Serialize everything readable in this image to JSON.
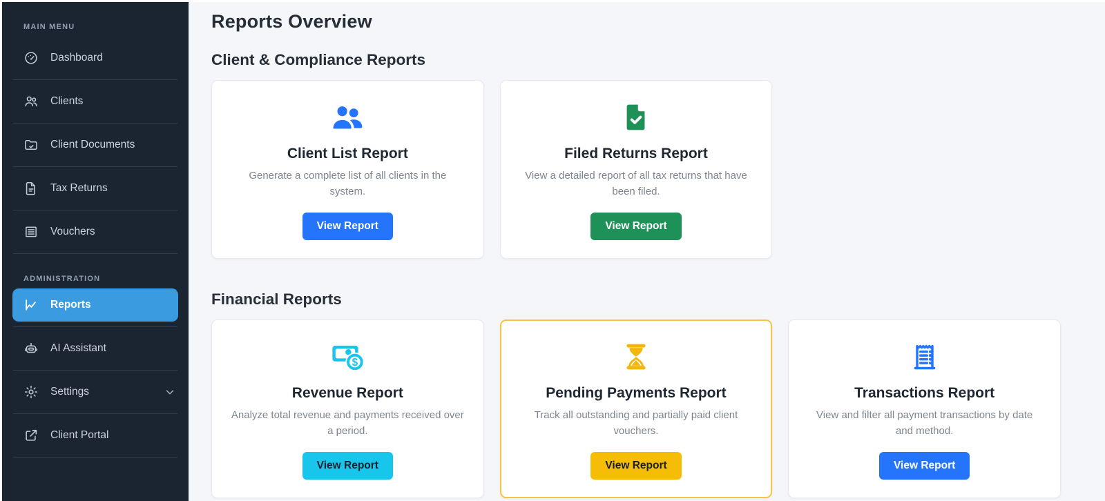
{
  "colors": {
    "sidebar_bg": "#1b2431",
    "active_item_bg": "#3a9be1",
    "primary_blue": "#2575fc",
    "green": "#1e9158",
    "cyan": "#17c6ea",
    "yellow": "#f5bd05",
    "highlight_border": "#f6c443",
    "content_bg": "#f5f6fa"
  },
  "sidebar": {
    "sections": [
      {
        "label": "MAIN MENU",
        "items": [
          {
            "label": "Dashboard",
            "icon": "dashboard-gauge-icon"
          },
          {
            "label": "Clients",
            "icon": "users-icon"
          },
          {
            "label": "Client Documents",
            "icon": "folder-check-icon"
          },
          {
            "label": "Tax Returns",
            "icon": "file-lines-icon"
          },
          {
            "label": "Vouchers",
            "icon": "receipt-lines-icon"
          }
        ]
      },
      {
        "label": "ADMINISTRATION",
        "items": [
          {
            "label": "Reports",
            "icon": "line-chart-icon",
            "active": true
          },
          {
            "label": "AI Assistant",
            "icon": "robot-icon"
          },
          {
            "label": "Settings",
            "icon": "gear-icon",
            "has_chevron": true
          },
          {
            "label": "Client Portal",
            "icon": "external-link-icon"
          }
        ]
      }
    ]
  },
  "main": {
    "title": "Reports Overview",
    "sections": [
      {
        "heading": "Client & Compliance Reports",
        "cards": [
          {
            "icon": "users-icon",
            "accent": "#2575fc",
            "title": "Client List Report",
            "description": "Generate a complete list of all clients in the system.",
            "button_label": "View Report"
          },
          {
            "icon": "file-check-icon",
            "accent": "#1e9158",
            "title": "Filed Returns Report",
            "description": "View a detailed report of all tax returns that have been filed.",
            "button_label": "View Report"
          }
        ]
      },
      {
        "heading": "Financial Reports",
        "cards": [
          {
            "icon": "banknote-dollar-icon",
            "accent": "#17c6ea",
            "title": "Revenue Report",
            "description": "Analyze total revenue and payments received over a period.",
            "button_label": "View Report"
          },
          {
            "icon": "hourglass-icon",
            "accent": "#f2b60d",
            "title": "Pending Payments Report",
            "description": "Track all outstanding and partially paid client vouchers.",
            "button_label": "View Report",
            "highlighted": true
          },
          {
            "icon": "receipt-icon",
            "accent": "#2575fc",
            "title": "Transactions Report",
            "description": "View and filter all payment transactions by date and method.",
            "button_label": "View Report"
          }
        ]
      }
    ]
  }
}
